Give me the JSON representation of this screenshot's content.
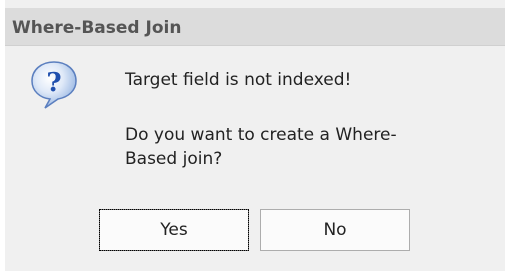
{
  "dialog": {
    "title": "Where-Based Join",
    "icon": "question-icon",
    "message_line1": "Target field is not indexed!",
    "message_line2": "Do you want to create a Where-Based join?",
    "buttons": {
      "yes_label": "Yes",
      "no_label": "No"
    },
    "colors": {
      "title_bg": "#dcdcdc",
      "title_text": "#555555",
      "icon_blue": "#2a6fd1"
    }
  }
}
